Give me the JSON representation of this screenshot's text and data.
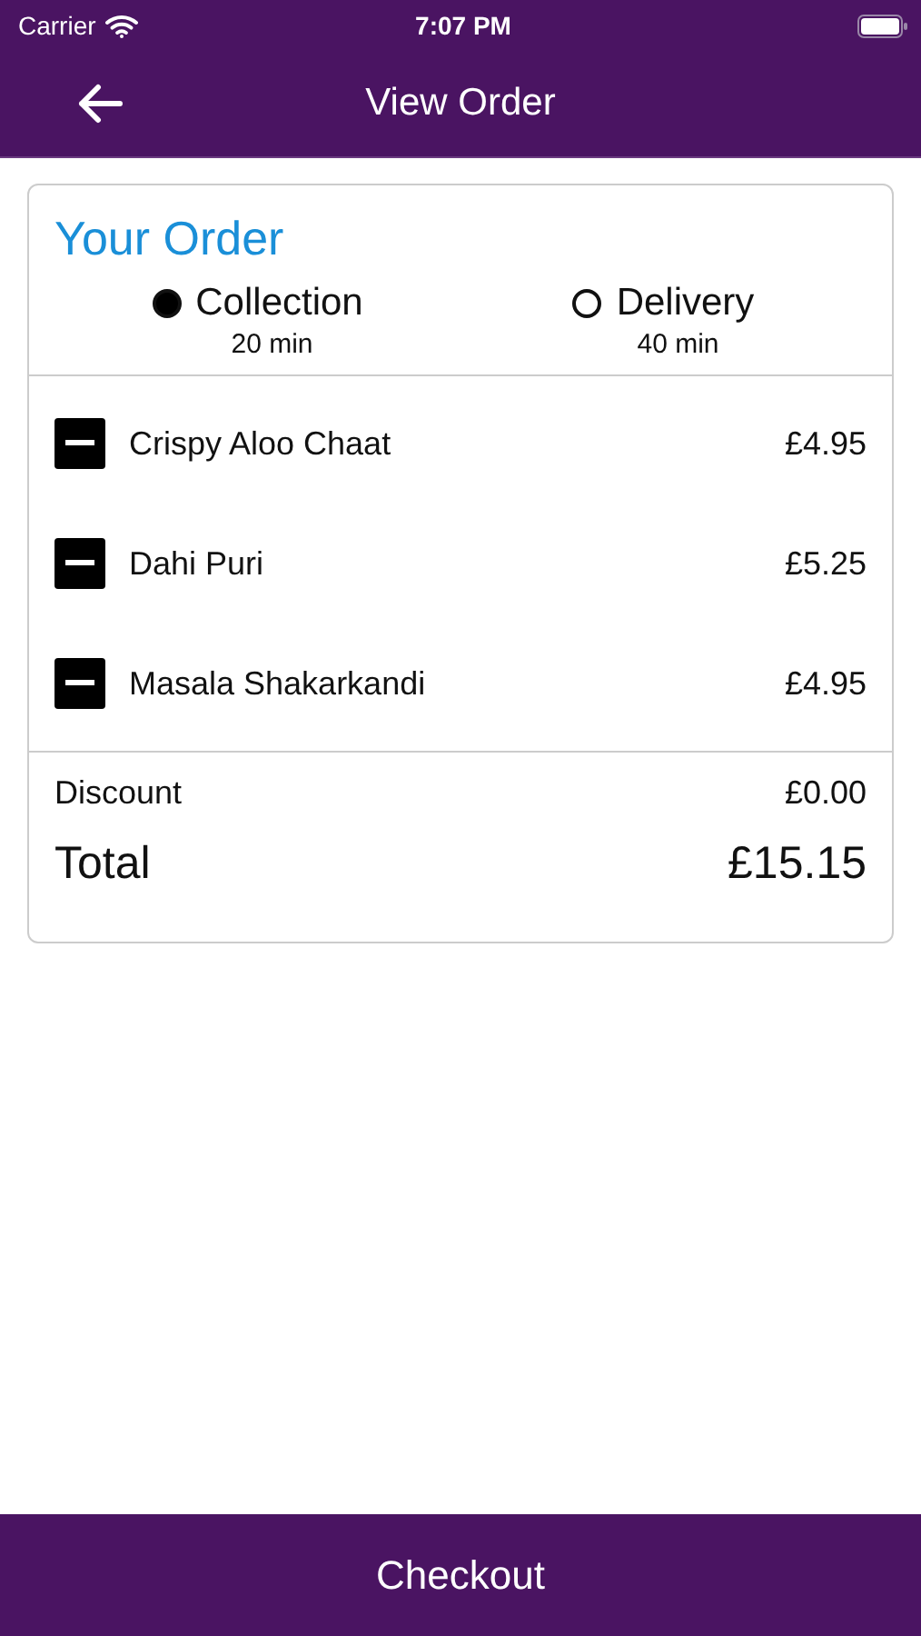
{
  "status_bar": {
    "carrier": "Carrier",
    "time": "7:07 PM"
  },
  "nav": {
    "title": "View Order"
  },
  "order": {
    "title": "Your Order",
    "options": [
      {
        "label": "Collection",
        "time": "20 min",
        "selected": true
      },
      {
        "label": "Delivery",
        "time": "40 min",
        "selected": false
      }
    ],
    "items": [
      {
        "name": "Crispy Aloo Chaat",
        "price": "£4.95"
      },
      {
        "name": "Dahi Puri",
        "price": "£5.25"
      },
      {
        "name": "Masala Shakarkandi",
        "price": "£4.95"
      }
    ],
    "discount": {
      "label": "Discount",
      "value": "£0.00"
    },
    "total": {
      "label": "Total",
      "value": "£15.15"
    }
  },
  "checkout": "Checkout"
}
